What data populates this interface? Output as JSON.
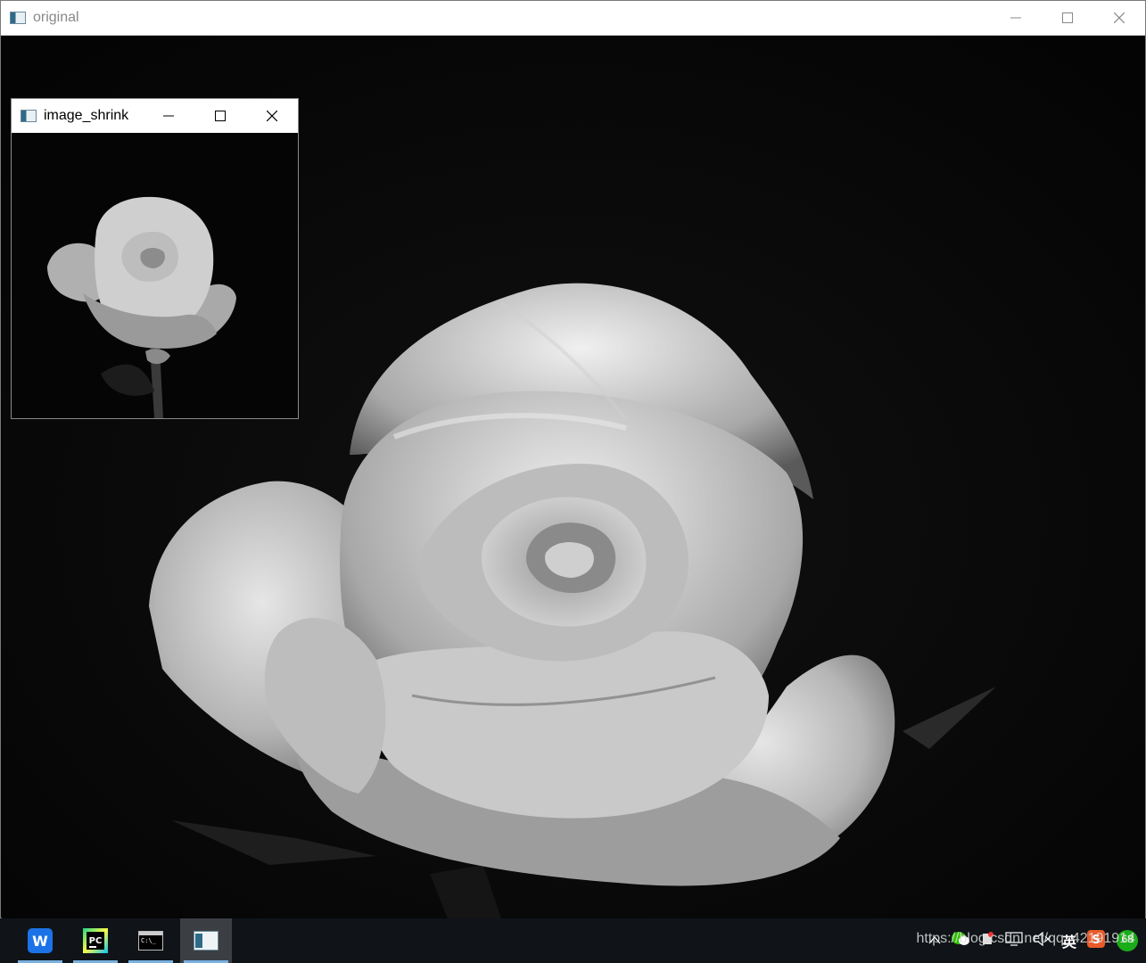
{
  "main_window": {
    "title": "original",
    "icon": "opencv-window-icon"
  },
  "child_window": {
    "title": "image_shrink",
    "icon": "opencv-window-icon"
  },
  "taskbar": {
    "items": [
      {
        "name": "wps-office",
        "icon": "wps-icon",
        "label": "W"
      },
      {
        "name": "pycharm",
        "icon": "pycharm-icon",
        "label": "PC"
      },
      {
        "name": "terminal",
        "icon": "terminal-icon",
        "label": ""
      },
      {
        "name": "opencv-window",
        "icon": "opencv-window-icon",
        "label": "",
        "active": true
      }
    ],
    "tray": {
      "ime_label": "英",
      "badge_count": "68"
    }
  },
  "watermark": "https://blog.csdn.net/qq_42191914",
  "colors": {
    "titlebar": "#ffffff",
    "taskbar": "#101418",
    "image_background": "#050505"
  }
}
